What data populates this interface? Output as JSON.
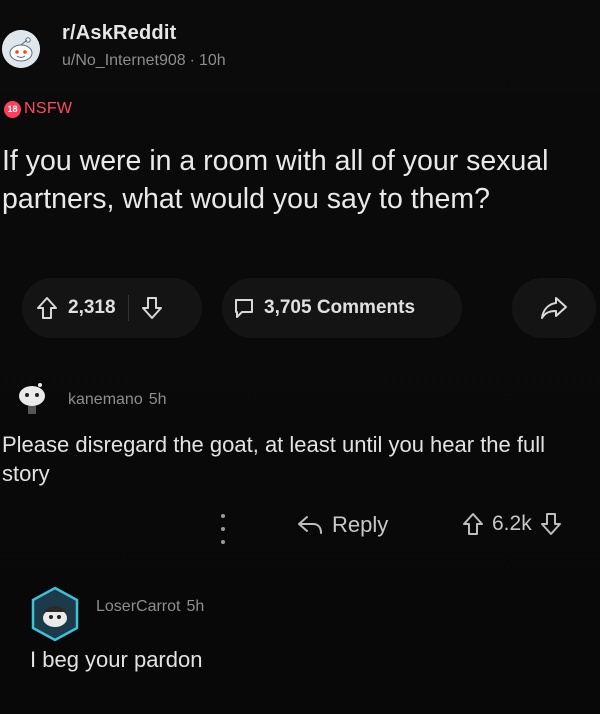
{
  "post": {
    "subreddit": "r/AskReddit",
    "author": "u/No_Internet908",
    "separator": "·",
    "age": "10h",
    "nsfw_label": "NSFW",
    "title": "If you were in a room with all of your sexual partners, what would you say to them?",
    "upvotes": "2,318",
    "comments_label": "3,705 Comments"
  },
  "comments": [
    {
      "username": "kanemano",
      "age": "5h",
      "body": "Please disregard the goat, at least until you hear the full story",
      "reply_label": "Reply",
      "score": "6.2k"
    },
    {
      "username": "LoserCarrot",
      "age": "5h",
      "body": "I beg your pardon"
    }
  ],
  "icons": {
    "subreddit_avatar": "snoo-avatar-icon",
    "nsfw": "nsfw-icon",
    "upvote": "upvote-arrow-icon",
    "downvote": "downvote-arrow-icon",
    "comment": "comment-bubble-icon",
    "share": "share-arrow-icon",
    "more": "more-vertical-icon",
    "reply": "reply-arrow-icon"
  },
  "colors": {
    "background": "#0b0b0b",
    "pill": "#141414",
    "nsfw": "#ff4a63",
    "text": "#e2e2e2",
    "muted": "#8c8e90"
  }
}
